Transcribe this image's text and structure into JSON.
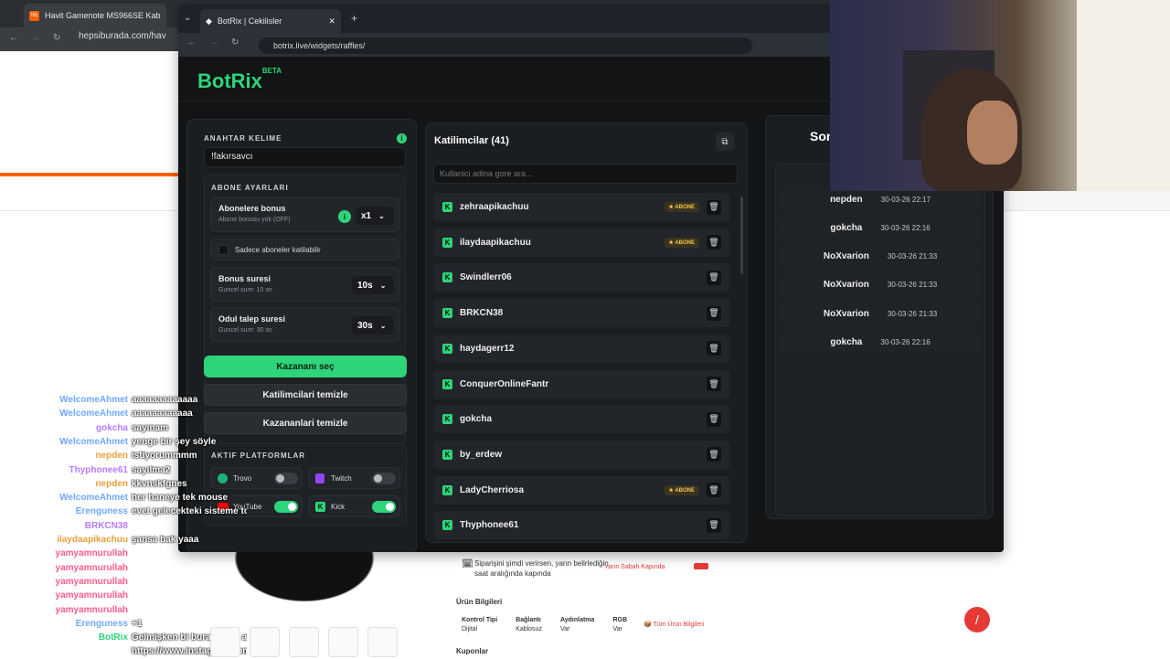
{
  "bg_browser": {
    "tab_title": "Havit Gamenote MS966SE Kab",
    "url": "hepsiburada.com/hav"
  },
  "botrix_window": {
    "tab_title": "BotRix | Cekilisler",
    "url": "botrix.live/widgets/raffles/",
    "logo": "BotRix",
    "beta": "BETA"
  },
  "settings": {
    "keyword_label": "ANAHTAR KELIME",
    "keyword_value": "!fakırsavcı",
    "sub_settings_label": "ABONE AYARLARI",
    "sub_bonus_title": "Abonelere bonus",
    "sub_bonus_desc": "Abone bonusu yok (OFF)",
    "sub_bonus_value": "x1",
    "subs_only_label": "Sadece aboneler katilabilir",
    "bonus_time_title": "Bonus suresi",
    "bonus_time_desc": "Guncel sure: 10 sn",
    "bonus_time_value": "10s",
    "claim_time_title": "Odul talep suresi",
    "claim_time_desc": "Guncel sure: 30 sn",
    "claim_time_value": "30s",
    "pick_winner": "Kazananı seç",
    "clear_participants": "Katilimcilari temizle",
    "clear_winners": "Kazananlari temizle",
    "platforms_label": "AKTIF PLATFORMLAR",
    "platforms": [
      {
        "name": "Trovo",
        "on": false
      },
      {
        "name": "Twitch",
        "on": false
      },
      {
        "name": "YouTube",
        "on": true
      },
      {
        "name": "Kick",
        "on": true
      }
    ]
  },
  "participants": {
    "title": "Katilimcilar (41)",
    "search_placeholder": "Kullanici adina gore ara...",
    "badge": "ABONE",
    "items": [
      {
        "name": "zehraapikachuu",
        "sub": true
      },
      {
        "name": "ilaydaapikachuu",
        "sub": true
      },
      {
        "name": "Swindlerr06",
        "sub": false
      },
      {
        "name": "BRKCN38",
        "sub": false
      },
      {
        "name": "haydagerr12",
        "sub": false
      },
      {
        "name": "ConquerOnlineFantr",
        "sub": false
      },
      {
        "name": "gokcha",
        "sub": false
      },
      {
        "name": "by_erdew",
        "sub": false
      },
      {
        "name": "LadyCherriosa",
        "sub": true
      },
      {
        "name": "Thyphonee61",
        "sub": false
      }
    ]
  },
  "winners": {
    "title": "Son",
    "items": [
      {
        "name": "nepden",
        "time": "30-03-26 22:17"
      },
      {
        "name": "gokcha",
        "time": "30-03-26 22:16"
      },
      {
        "name": "NoXvarion",
        "time": "30-03-26 21:33"
      },
      {
        "name": "NoXvarion",
        "time": "30-03-26 21:33"
      },
      {
        "name": "NoXvarion",
        "time": "30-03-26 21:33"
      },
      {
        "name": "gokcha",
        "time": "30-03-26 22:16"
      }
    ]
  },
  "chat": [
    {
      "user": "WelcomeAhmet",
      "msg": "aaaaaaaaaaaaa",
      "color": "#6fa8ff"
    },
    {
      "user": "WelcomeAhmet",
      "msg": "aaaaaaaaaaaa",
      "color": "#6fa8ff"
    },
    {
      "user": "gokcha",
      "msg": "sayınam",
      "color": "#b57cff"
    },
    {
      "user": "WelcomeAhmet",
      "msg": "yenge bir şey söyle",
      "color": "#6fa8ff"
    },
    {
      "user": "nepden",
      "msg": "istiyorummmm",
      "color": "#e8a040"
    },
    {
      "user": "Thyphonee61",
      "msg": "sayılma2",
      "color": "#b57cff"
    },
    {
      "user": "nepden",
      "msg": "kkvnskfgnes",
      "color": "#e8a040"
    },
    {
      "user": "WelcomeAhmet",
      "msg": "her haneye tek mouse",
      "color": "#6fa8ff"
    },
    {
      "user": "Erenguness",
      "msg": "evet gelecekteki sisteme toplayacak",
      "color": "#6fa8ff"
    },
    {
      "user": "BRKCN38",
      "msg": "",
      "color": "#b57cff"
    },
    {
      "user": "ilaydaapikachuu",
      "msg": "şansa bak yaaa",
      "color": "#e8a040"
    },
    {
      "user": "yamyamnurullah",
      "msg": "",
      "color": "#ff5a8a"
    },
    {
      "user": "yamyamnurullah",
      "msg": "",
      "color": "#ff5a8a"
    },
    {
      "user": "yamyamnurullah",
      "msg": "",
      "color": "#ff5a8a"
    },
    {
      "user": "yamyamnurullah",
      "msg": "",
      "color": "#ff5a8a"
    },
    {
      "user": "yamyamnurullah",
      "msg": "",
      "color": "#ff5a8a"
    },
    {
      "user": "Erenguness",
      "msg": "+1",
      "color": "#6fa8ff"
    },
    {
      "user": "BotRix",
      "msg": "Gelmişken bi buraya göz at be reis!",
      "color": "#2ed47a"
    },
    {
      "user": "",
      "msg": "https://www.instagram.com/sarilovhuseyin",
      "color": "#6fa8ff"
    }
  ],
  "product": {
    "delivery_text": "Siparişini şimdi verirsen, yarın belirlediğin saat aralığında kapında",
    "delivery_badge": "Yarın Sabah Kapında",
    "info_title": "Ürün Bilgileri",
    "specs": [
      {
        "k": "Kontrol Tipi",
        "v": "Dijital"
      },
      {
        "k": "Bağlantı",
        "v": "Kablosuz"
      },
      {
        "k": "Aydınlatma",
        "v": "Var"
      },
      {
        "k": "RGB",
        "v": "Var"
      }
    ],
    "all_info": "Tüm Ürün Bilgileri",
    "coupons": "Kuponlar"
  }
}
